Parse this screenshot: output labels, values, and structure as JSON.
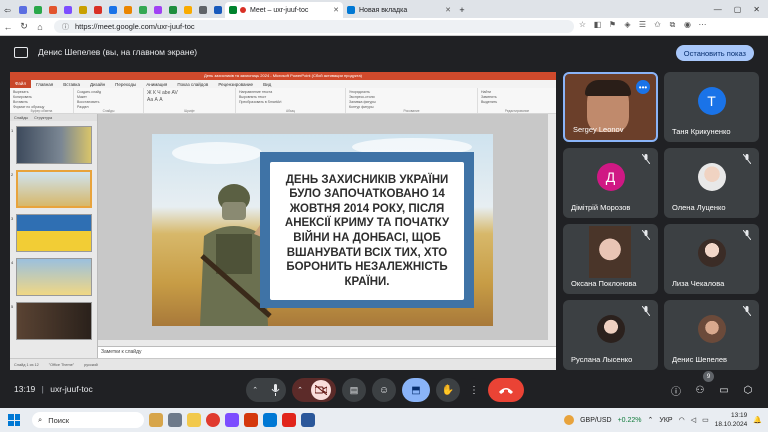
{
  "browser": {
    "tabs": [
      {
        "label": "Meet – uxr-juuf-toc",
        "active": true
      },
      {
        "label": "Новая вкладка",
        "active": false
      }
    ],
    "url": "https://meet.google.com/uxr-juuf-toc",
    "new_tab_label": "+"
  },
  "presentation_bar": {
    "text": "Денис Шепелев (вы, на главном экране)",
    "stop_label": "Остановить показ"
  },
  "powerpoint": {
    "title": "День захисників та захисниць 2024 - Microsoft PowerPoint (Сбой активации продукта)",
    "tabs": [
      "Файл",
      "Главная",
      "Вставка",
      "Дизайн",
      "Переходы",
      "Анимация",
      "Показ слайдов",
      "Рецензирование",
      "Вид"
    ],
    "ribbon_groups": [
      {
        "label": "Буфер обмена",
        "lines": [
          "Вырезать",
          "Копировать",
          "Вставить",
          "Формат по образцу"
        ]
      },
      {
        "label": "Слайды",
        "lines": [
          "Создать слайд",
          "Макет",
          "Восстановить",
          "Раздел"
        ]
      },
      {
        "label": "Шрифт",
        "lines": [
          "Ж К Ч abe AV",
          "Аа А А"
        ]
      },
      {
        "label": "Абзац",
        "lines": [
          "Направление текста",
          "Выровнять текст",
          "Преобразовать в SmartArt"
        ]
      },
      {
        "label": "Рисование",
        "lines": [
          "Упорядочить",
          "Экспресс-стили",
          "Заливка фигуры",
          "Контур фигуры",
          "Эффекты фигур"
        ]
      },
      {
        "label": "Редактирование",
        "lines": [
          "Найти",
          "Заменить",
          "Выделить"
        ]
      }
    ],
    "panel_tabs": [
      "Слайды",
      "Структура"
    ],
    "thumb_numbers": [
      "1",
      "2",
      "3",
      "4",
      "5"
    ],
    "slide_text": "ДЕНЬ ЗАХИСНИКІВ УКРАЇНИ БУЛО ЗАПОЧАТКОВАНО 14 ЖОВТНЯ 2014 РОКУ, ПІСЛЯ АНЕКСІЇ КРИМУ ТА ПОЧАТКУ ВІЙНИ НА ДОНБАСІ, ЩОБ ВШАНУВАТИ ВСІХ ТИХ, ХТО БОРОНИТЬ НЕЗАЛЕЖНІСТЬ КРАЇНИ.",
    "notes_placeholder": "Заметки к слайду",
    "status": [
      "Слайд 1 из 12",
      "\"Office Theme\"",
      "русский"
    ]
  },
  "participants": [
    {
      "name": "Sergey Leonov",
      "type": "video"
    },
    {
      "name": "Таня Крикуненко",
      "initial": "Т",
      "color": "#1a73e8"
    },
    {
      "name": "Дімітрій Морозов",
      "initial": "Д",
      "color": "#d01884"
    },
    {
      "name": "Олена Луценко",
      "type": "photo"
    },
    {
      "name": "Оксана Поклонова",
      "type": "photo"
    },
    {
      "name": "Лиза Чекалова",
      "type": "photo"
    },
    {
      "name": "Руслана Лысенко",
      "type": "photo"
    },
    {
      "name": "Денис Шепелев",
      "type": "photo"
    }
  ],
  "controls": {
    "time": "13:19",
    "code": "uxr-juuf-toc",
    "people_count": "9"
  },
  "taskbar": {
    "search_label": "Поиск",
    "ticker": "GBP/USD",
    "ticker_change": "+0.22%",
    "lang": "УКР",
    "time": "13:19",
    "date": "18.10.2024"
  },
  "colors": {
    "accent": "#a8c7fa",
    "hangup": "#ea4335",
    "active_share": "#8ab4f8",
    "cam_off": "#f9dedc"
  }
}
